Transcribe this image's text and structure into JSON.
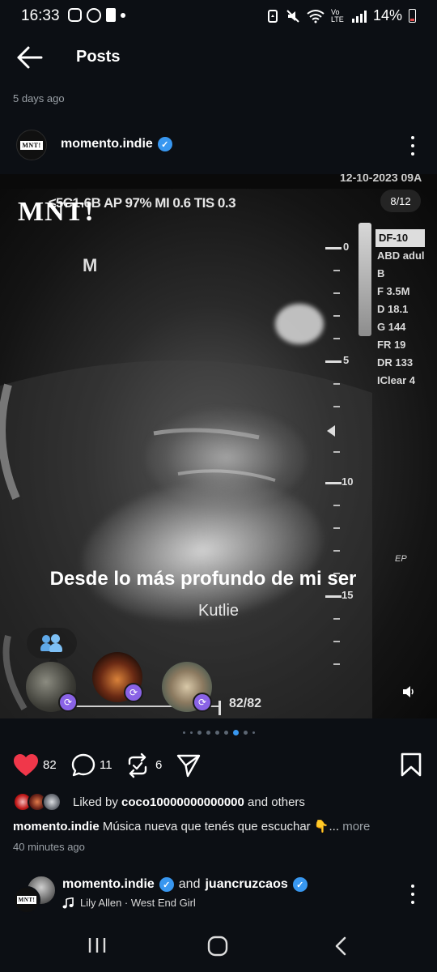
{
  "status_bar": {
    "time": "16:33",
    "battery": "14%",
    "network_label": "Vo LTE"
  },
  "header": {
    "title": "Posts",
    "posted_ago": "5 days ago"
  },
  "post": {
    "username": "momento.indie",
    "avatar_text": "MNT!",
    "media": {
      "logo": "MNT!",
      "carousel_badge": "8/12",
      "ultrasound_header": "≤5C1-6B  AP 97%  MI 0.6  TIS 0.3",
      "ultrasound_date": "12-10-2023 09A",
      "mode_label": "M",
      "params": [
        "ABD adul",
        "B",
        "F 3.5M",
        "D 18.1",
        "G 144",
        "FR 19",
        "DR 133",
        "IClear 4"
      ],
      "params_header": "DF-10",
      "scale_marks": [
        "0",
        "5",
        "10",
        "15"
      ],
      "ep_label": "EP",
      "song_title": "Desde lo más profundo de mi ser",
      "artist": "Kutlie",
      "counter": "82/82"
    },
    "actions": {
      "likes": "82",
      "comments": "11",
      "reposts": "6"
    },
    "liked_by": {
      "prefix": "Liked by",
      "user": "coco10000000000000",
      "suffix": "and others"
    },
    "caption": {
      "user": "momento.indie",
      "text": "Música nueva que tenés que escuchar 👇...",
      "more": "more"
    },
    "time": "40 minutes ago"
  },
  "next_post": {
    "username": "momento.indie",
    "and": "and",
    "collab": "juancruzcaos",
    "music": "Lily Allen · West End Girl"
  },
  "colors": {
    "background": "#0c0f14",
    "like_red": "#f0374a",
    "verified_blue": "#3897f0",
    "repost_purple": "#8a63e6"
  }
}
